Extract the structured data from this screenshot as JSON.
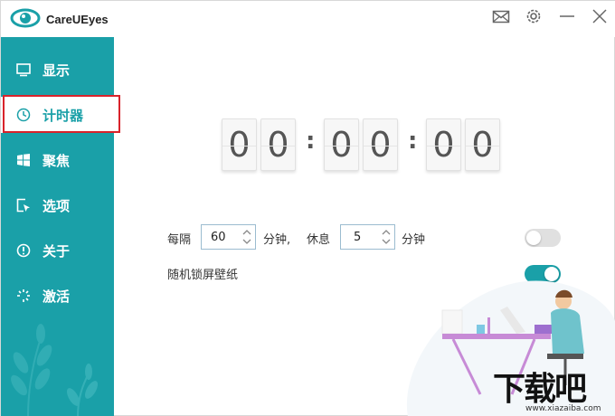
{
  "app": {
    "title": "CareUEyes"
  },
  "sidebar": {
    "items": [
      {
        "label": "显示",
        "icon": "monitor-icon"
      },
      {
        "label": "计时器",
        "icon": "clock-icon",
        "active": true
      },
      {
        "label": "聚焦",
        "icon": "windows-icon"
      },
      {
        "label": "选项",
        "icon": "cursor-icon"
      },
      {
        "label": "关于",
        "icon": "info-icon"
      },
      {
        "label": "激活",
        "icon": "sparkle-icon"
      }
    ]
  },
  "timer": {
    "digits": [
      "0",
      "0",
      "0",
      "0",
      "0",
      "0"
    ],
    "separator": ":"
  },
  "settings": {
    "every_label": "每隔",
    "interval_value": "60",
    "minutes_comma": "分钟,",
    "rest_label": "休息",
    "rest_value": "5",
    "minutes_label": "分钟",
    "random_wallpaper_label": "随机锁屏壁纸",
    "break_toggle_on": false,
    "wallpaper_toggle_on": true
  },
  "watermark": {
    "text": "下载吧",
    "url": "www.xiazaiba.com"
  },
  "colors": {
    "accent": "#1aa0a8",
    "highlight": "#d9232b"
  }
}
